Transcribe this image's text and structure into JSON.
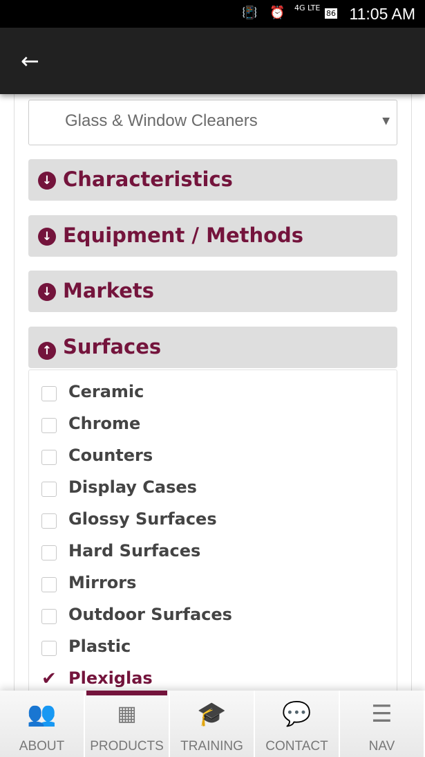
{
  "status_bar": {
    "time": "11:05 AM",
    "battery": "86",
    "network": "4G LTE"
  },
  "filter_select": {
    "value": "Glass & Window Cleaners"
  },
  "accordions": [
    {
      "label": "Characteristics",
      "expanded": false
    },
    {
      "label": "Equipment / Methods",
      "expanded": false
    },
    {
      "label": "Markets",
      "expanded": false
    },
    {
      "label": "Surfaces",
      "expanded": true
    }
  ],
  "surfaces": [
    {
      "label": "Ceramic",
      "checked": false
    },
    {
      "label": "Chrome",
      "checked": false
    },
    {
      "label": "Counters",
      "checked": false
    },
    {
      "label": "Display Cases",
      "checked": false
    },
    {
      "label": "Glossy Surfaces",
      "checked": false
    },
    {
      "label": "Hard Surfaces",
      "checked": false
    },
    {
      "label": "Mirrors",
      "checked": false
    },
    {
      "label": "Outdoor Surfaces",
      "checked": false
    },
    {
      "label": "Plastic",
      "checked": false
    },
    {
      "label": "Plexiglas",
      "checked": true
    }
  ],
  "bottom_nav": [
    {
      "label": "ABOUT",
      "icon": "users-icon"
    },
    {
      "label": "PRODUCTS",
      "icon": "grid-icon",
      "active": true
    },
    {
      "label": "TRAINING",
      "icon": "graduation-cap-icon"
    },
    {
      "label": "CONTACT",
      "icon": "chat-icon"
    },
    {
      "label": "NAV",
      "icon": "menu-icon"
    }
  ],
  "colors": {
    "accent": "#74143c",
    "appbar": "#212121"
  }
}
